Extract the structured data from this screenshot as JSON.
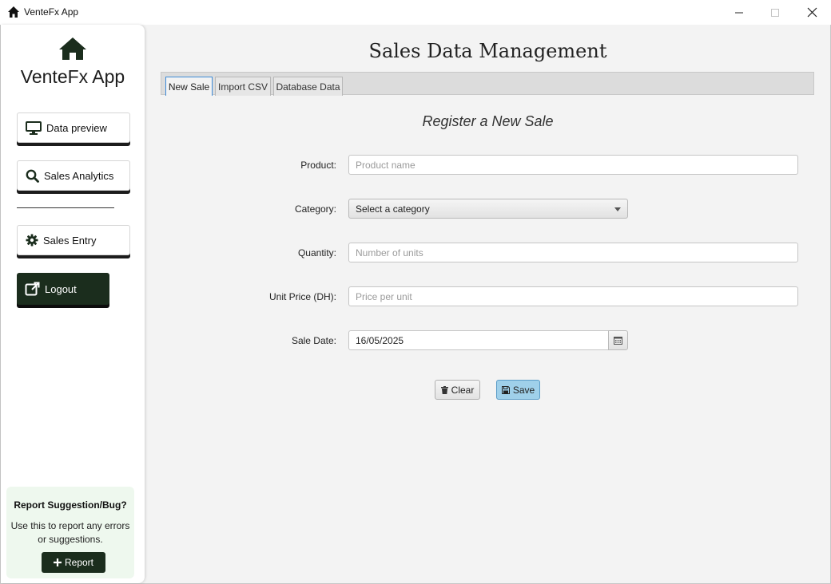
{
  "window": {
    "title": "VenteFx App",
    "controls": [
      "minimize",
      "maximize",
      "close"
    ]
  },
  "sidebar": {
    "brand": "VenteFx App",
    "items": [
      {
        "label": "Data preview",
        "icon": "monitor-icon"
      },
      {
        "label": "Sales Analytics",
        "icon": "search-icon"
      },
      {
        "label": "Sales Entry",
        "icon": "gear-icon"
      }
    ],
    "logout_label": "Logout",
    "report": {
      "title": "Report Suggestion/Bug?",
      "description": "Use this to report any errors or suggestions.",
      "button_label": "Report"
    }
  },
  "main": {
    "title": "Sales Data Management",
    "tabs": [
      {
        "label": "New Sale",
        "active": true
      },
      {
        "label": "Import CSV",
        "active": false
      },
      {
        "label": "Database Data",
        "active": false
      }
    ],
    "form": {
      "heading": "Register a New Sale",
      "product": {
        "label": "Product:",
        "placeholder": "Product name",
        "value": ""
      },
      "category": {
        "label": "Category:",
        "selected": "Select a category"
      },
      "quantity": {
        "label": "Quantity:",
        "placeholder": "Number of units",
        "value": ""
      },
      "unit_price": {
        "label": "Unit Price (DH):",
        "placeholder": "Price per unit",
        "value": ""
      },
      "sale_date": {
        "label": "Sale Date:",
        "value": "16/05/2025"
      },
      "clear_label": "Clear",
      "save_label": "Save"
    }
  },
  "colors": {
    "accent_dark_green": "#1b2d1d",
    "save_blue": "#9fd0ea",
    "tab_focus_blue": "#3d8bd8",
    "report_bg": "#eef8ee"
  }
}
